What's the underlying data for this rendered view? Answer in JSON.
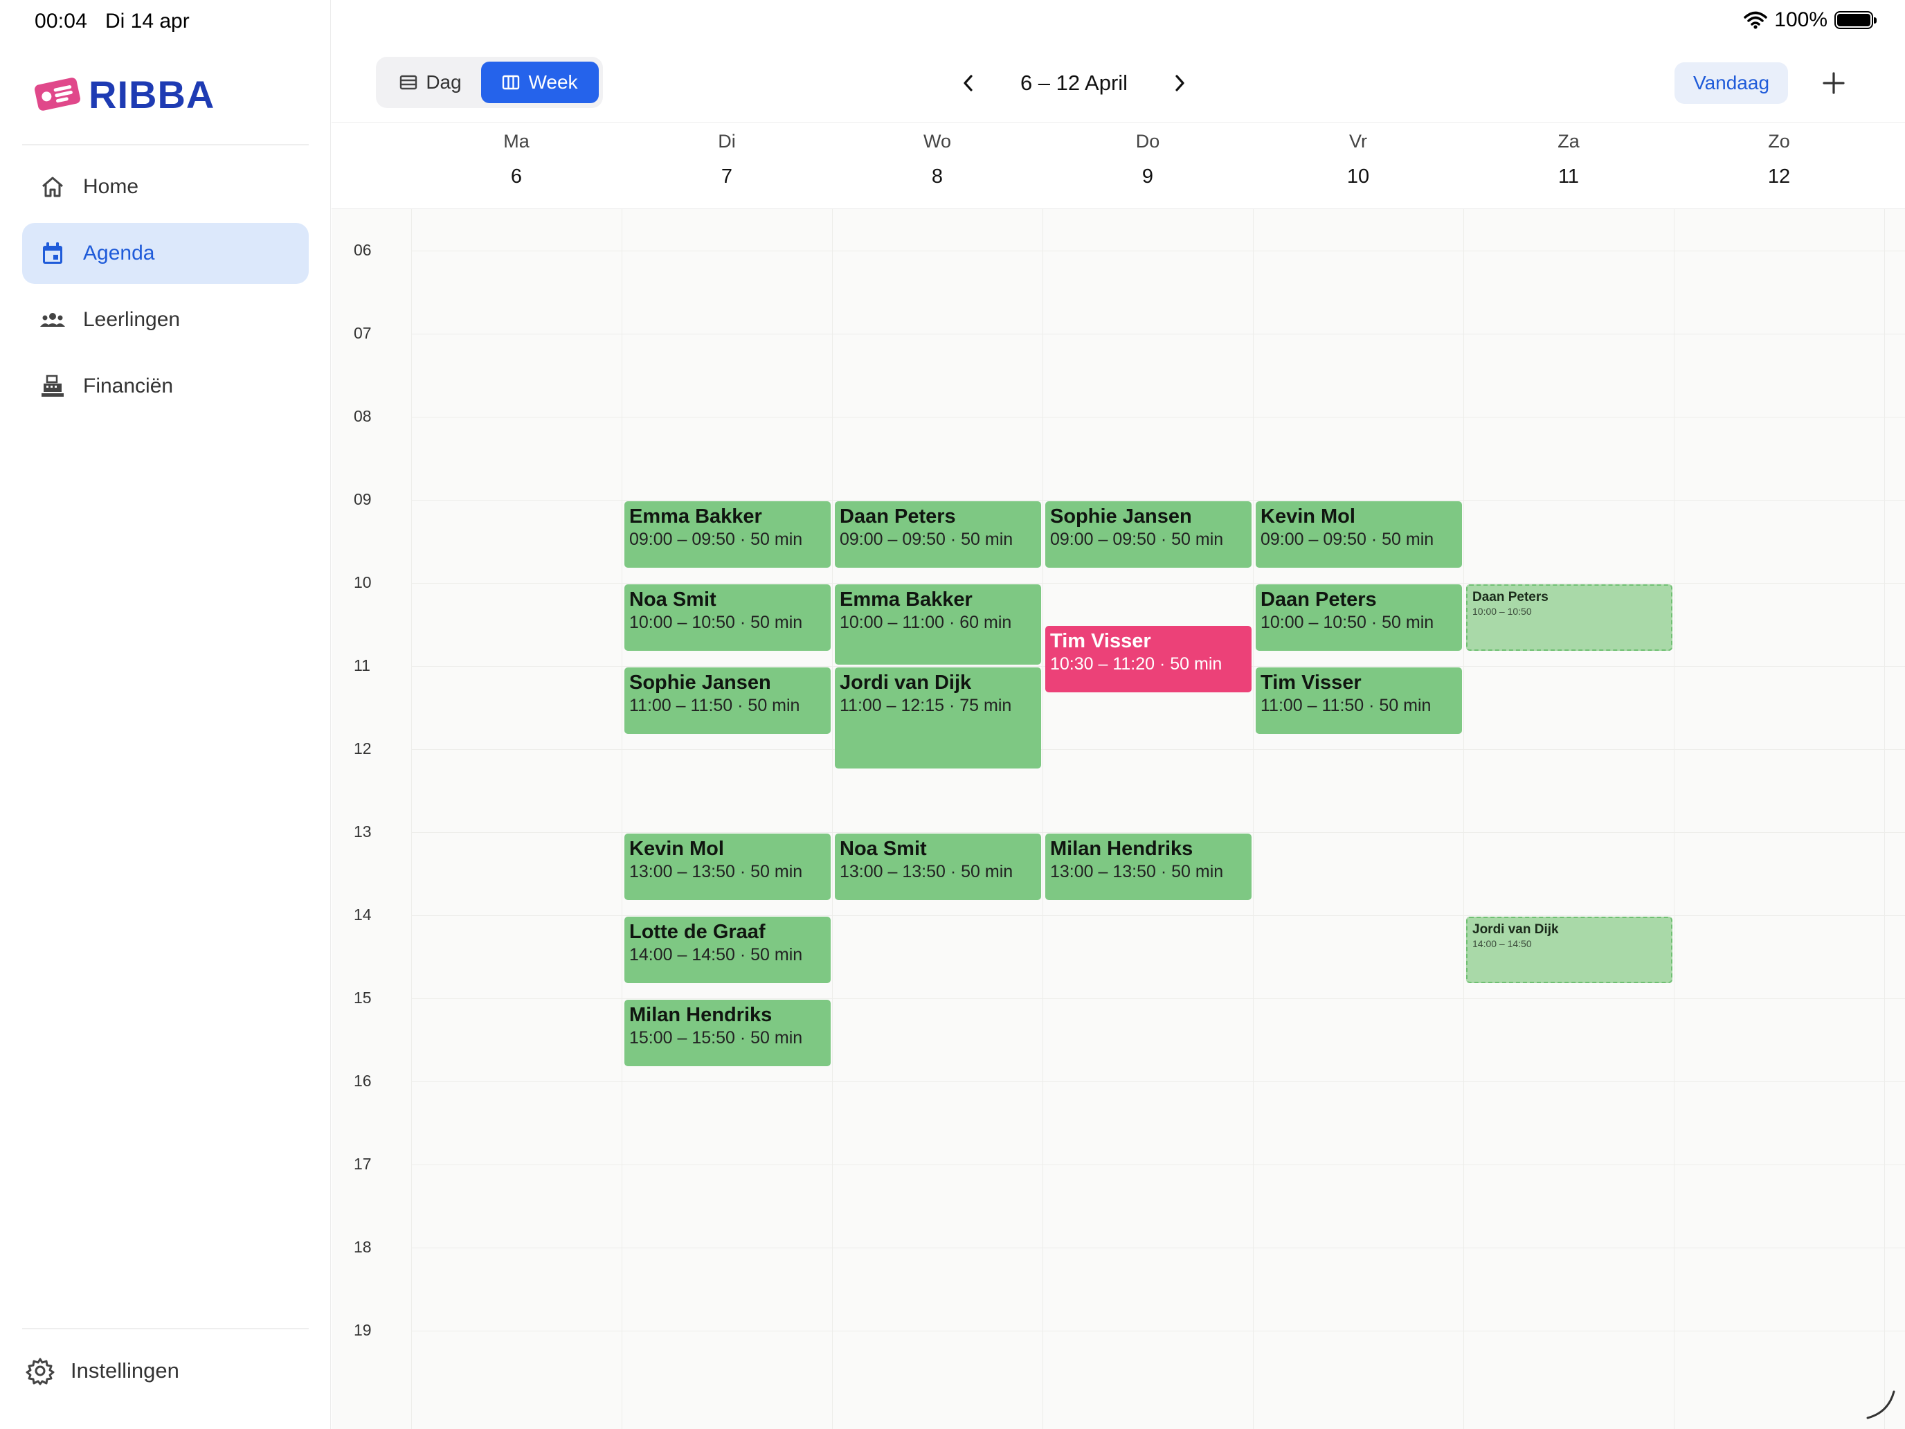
{
  "statusbar": {
    "time": "00:04",
    "date": "Di 14 apr",
    "battery": "100%"
  },
  "app": {
    "logo_text": "RIBBA",
    "brand_color": "#1e3bb3",
    "accent_color": "#2563eb"
  },
  "sidebar": {
    "items": [
      {
        "label": "Home",
        "icon": "home-icon",
        "active": false
      },
      {
        "label": "Agenda",
        "icon": "calendar-icon",
        "active": true
      },
      {
        "label": "Leerlingen",
        "icon": "students-icon",
        "active": false
      },
      {
        "label": "Financiën",
        "icon": "register-icon",
        "active": false
      }
    ],
    "settings_label": "Instellingen"
  },
  "toolbar": {
    "view_day_label": "Dag",
    "view_week_label": "Week",
    "range_title": "6 – 12 April",
    "today_label": "Vandaag"
  },
  "days": [
    {
      "weekday": "Ma",
      "date": "6"
    },
    {
      "weekday": "Di",
      "date": "7"
    },
    {
      "weekday": "Wo",
      "date": "8"
    },
    {
      "weekday": "Do",
      "date": "9"
    },
    {
      "weekday": "Vr",
      "date": "10"
    },
    {
      "weekday": "Za",
      "date": "11"
    },
    {
      "weekday": "Zo",
      "date": "12"
    }
  ],
  "hours": [
    "06",
    "07",
    "08",
    "09",
    "10",
    "11",
    "12",
    "13",
    "14",
    "15",
    "16",
    "17",
    "18",
    "19"
  ],
  "events": [
    {
      "day": 1,
      "name": "Emma Bakker",
      "time": "09:00 – 09:50  ·  50 min",
      "start": 9.0,
      "end": 9.833,
      "style": "green"
    },
    {
      "day": 1,
      "name": "Noa Smit",
      "time": "10:00 – 10:50  ·  50 min",
      "start": 10.0,
      "end": 10.833,
      "style": "green"
    },
    {
      "day": 1,
      "name": "Sophie Jansen",
      "time": "11:00 – 11:50  ·  50 min",
      "start": 11.0,
      "end": 11.833,
      "style": "green"
    },
    {
      "day": 1,
      "name": "Kevin Mol",
      "time": "13:00 – 13:50  ·  50 min",
      "start": 13.0,
      "end": 13.833,
      "style": "green"
    },
    {
      "day": 1,
      "name": "Lotte de Graaf",
      "time": "14:00 – 14:50  ·  50 min",
      "start": 14.0,
      "end": 14.833,
      "style": "green"
    },
    {
      "day": 1,
      "name": "Milan Hendriks",
      "time": "15:00 – 15:50  ·  50 min",
      "start": 15.0,
      "end": 15.833,
      "style": "green"
    },
    {
      "day": 2,
      "name": "Daan Peters",
      "time": "09:00 – 09:50  ·  50 min",
      "start": 9.0,
      "end": 9.833,
      "style": "green"
    },
    {
      "day": 2,
      "name": "Emma Bakker",
      "time": "10:00 – 11:00  ·  60 min",
      "start": 10.0,
      "end": 11.0,
      "style": "green"
    },
    {
      "day": 2,
      "name": "Jordi van Dijk",
      "time": "11:00 – 12:15  ·  75 min",
      "start": 11.0,
      "end": 12.25,
      "style": "green"
    },
    {
      "day": 2,
      "name": "Noa Smit",
      "time": "13:00 – 13:50  ·  50 min",
      "start": 13.0,
      "end": 13.833,
      "style": "green"
    },
    {
      "day": 3,
      "name": "Sophie Jansen",
      "time": "09:00 – 09:50  ·  50 min",
      "start": 9.0,
      "end": 9.833,
      "style": "green"
    },
    {
      "day": 3,
      "name": "Tim Visser",
      "time": "10:30 – 11:20  ·  50 min",
      "start": 10.5,
      "end": 11.333,
      "style": "pink"
    },
    {
      "day": 3,
      "name": "Milan Hendriks",
      "time": "13:00 – 13:50  ·  50 min",
      "start": 13.0,
      "end": 13.833,
      "style": "green"
    },
    {
      "day": 4,
      "name": "Kevin Mol",
      "time": "09:00 – 09:50  ·  50 min",
      "start": 9.0,
      "end": 9.833,
      "style": "green"
    },
    {
      "day": 4,
      "name": "Daan Peters",
      "time": "10:00 – 10:50  ·  50 min",
      "start": 10.0,
      "end": 10.833,
      "style": "green"
    },
    {
      "day": 4,
      "name": "Tim Visser",
      "time": "11:00 – 11:50  ·  50 min",
      "start": 11.0,
      "end": 11.833,
      "style": "green"
    },
    {
      "day": 5,
      "name": "Daan Peters",
      "time": "10:00 – 10:50",
      "start": 10.0,
      "end": 10.833,
      "style": "ghost"
    },
    {
      "day": 5,
      "name": "Jordi van Dijk",
      "time": "14:00 – 14:50",
      "start": 14.0,
      "end": 14.833,
      "style": "ghost"
    }
  ]
}
